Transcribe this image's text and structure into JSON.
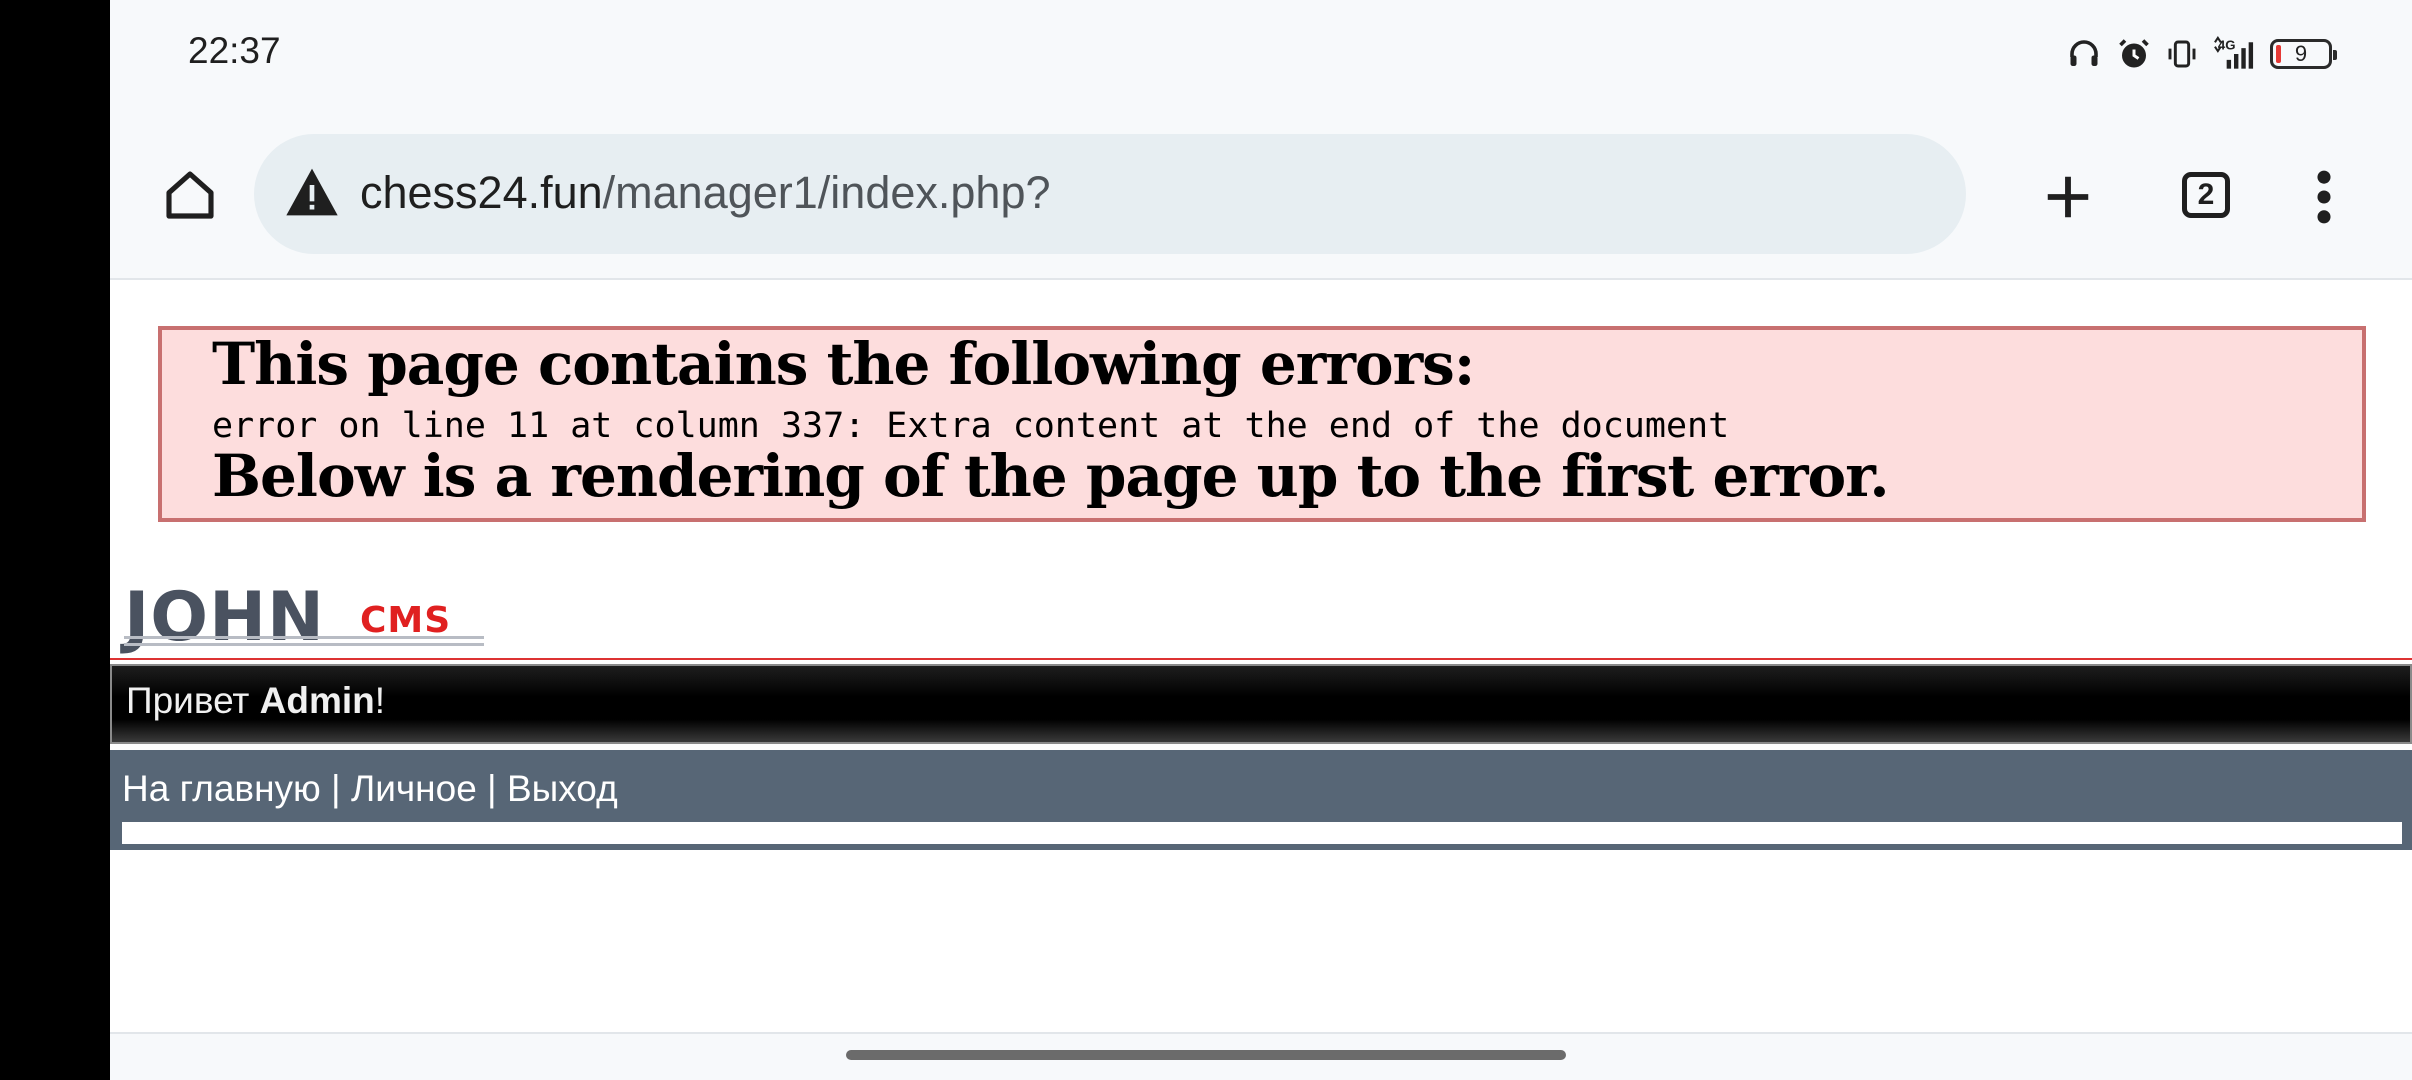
{
  "status_bar": {
    "time": "22:37",
    "battery_level": "9",
    "icons": [
      "headphones-icon",
      "alarm-icon",
      "vibrate-icon",
      "signal-4g-icon",
      "battery-icon"
    ]
  },
  "browser": {
    "url_host": "chess24.fun",
    "url_path": "/manager1/index.php?",
    "tab_count": "2",
    "icons": [
      "home-icon",
      "warning-icon",
      "plus-icon",
      "tabs-icon",
      "more-vert-icon"
    ]
  },
  "error": {
    "title": "This page contains the following errors:",
    "detail": "error on line 11 at column 337: Extra content at the end of the document",
    "below": "Below is a rendering of the page up to the first error."
  },
  "logo": {
    "john": "JOHN",
    "cms": "CMS"
  },
  "greeting": {
    "prefix": "Привет ",
    "user": "Admin",
    "suffix": "!"
  },
  "nav": {
    "home": "На главную",
    "sep1": " | ",
    "personal": "Личное",
    "sep2": " | ",
    "logout": "Выход"
  },
  "colors": {
    "error_bg": "#fddddd",
    "error_border": "#c87070",
    "nav_bg": "#576676",
    "logo_red": "#e02020"
  }
}
